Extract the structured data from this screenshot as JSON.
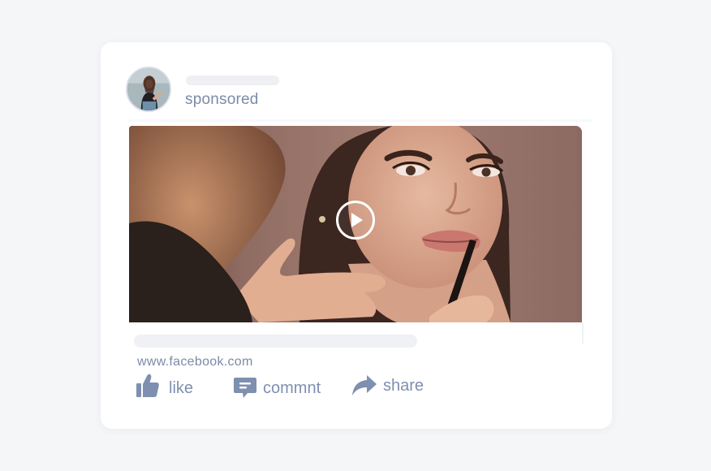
{
  "post": {
    "sponsored_label": "sponsored",
    "link_url": "www.facebook.com",
    "media": {
      "type": "video",
      "play_icon": "play-icon"
    }
  },
  "actions": {
    "like_label": "like",
    "comment_label": "commnt",
    "share_label": "share"
  },
  "colors": {
    "page_background": "#f5f6f8",
    "card_background": "#ffffff",
    "accent_text": "#7f8fb0",
    "placeholder": "#eef0f3"
  }
}
